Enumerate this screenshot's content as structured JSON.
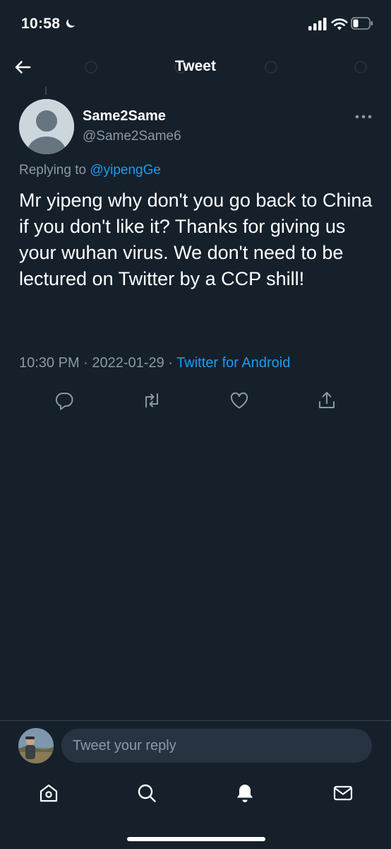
{
  "status_bar": {
    "time": "10:58"
  },
  "header": {
    "title": "Tweet"
  },
  "tweet": {
    "author_name": "Same2Same",
    "author_handle": "@Same2Same6",
    "replying_prefix": "Replying to",
    "replying_to": "@yipengGe",
    "text": "Mr yipeng why don't you go back to China if you don't like it? Thanks for giving us your wuhan virus. We don't need to be lectured on Twitter by a CCP shill!",
    "time": "10:30 PM",
    "separator": "·",
    "date": "2022-01-29",
    "source": "Twitter for Android"
  },
  "composer": {
    "placeholder": "Tweet your reply"
  },
  "colors": {
    "background": "#15202b",
    "accent": "#1d9bf0",
    "secondary_text": "#8b98a5",
    "divider": "#38444d",
    "input_bg": "#273340"
  },
  "icons": {
    "back": "arrow-left-icon",
    "more": "more-horizontal-icon",
    "reply": "reply-icon",
    "retweet": "retweet-icon",
    "like": "heart-icon",
    "share": "share-icon",
    "nav_home": "home-icon",
    "nav_search": "search-icon",
    "nav_notifications": "bell-icon",
    "nav_messages": "mail-icon"
  }
}
